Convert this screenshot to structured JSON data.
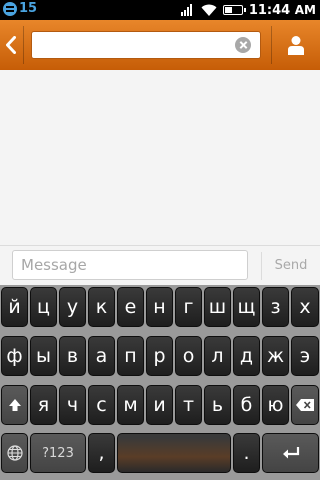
{
  "status_bar": {
    "notification_count": "15",
    "time": "11:44",
    "ampm": "AM",
    "icons": [
      "notification-icon",
      "signal-icon",
      "wifi-icon",
      "battery-icon"
    ],
    "battery_level": 0.4
  },
  "header": {
    "recipient_value": "",
    "icons": [
      "back-icon",
      "clear-icon",
      "contact-icon"
    ],
    "accent_color": "#d8700f"
  },
  "compose": {
    "placeholder": "Message",
    "send_label": "Send"
  },
  "keyboard": {
    "row1": [
      "й",
      "ц",
      "у",
      "к",
      "е",
      "н",
      "г",
      "ш",
      "щ",
      "з",
      "х"
    ],
    "row2": [
      "ф",
      "ы",
      "в",
      "а",
      "п",
      "р",
      "о",
      "л",
      "д",
      "ж",
      "э"
    ],
    "row3": [
      "я",
      "ч",
      "с",
      "м",
      "и",
      "т",
      "ь",
      "б",
      "ю"
    ],
    "symbols_label": "?123",
    "comma": ",",
    "period": ".",
    "icons": [
      "shift-icon",
      "backspace-icon",
      "globe-icon",
      "enter-icon"
    ]
  }
}
